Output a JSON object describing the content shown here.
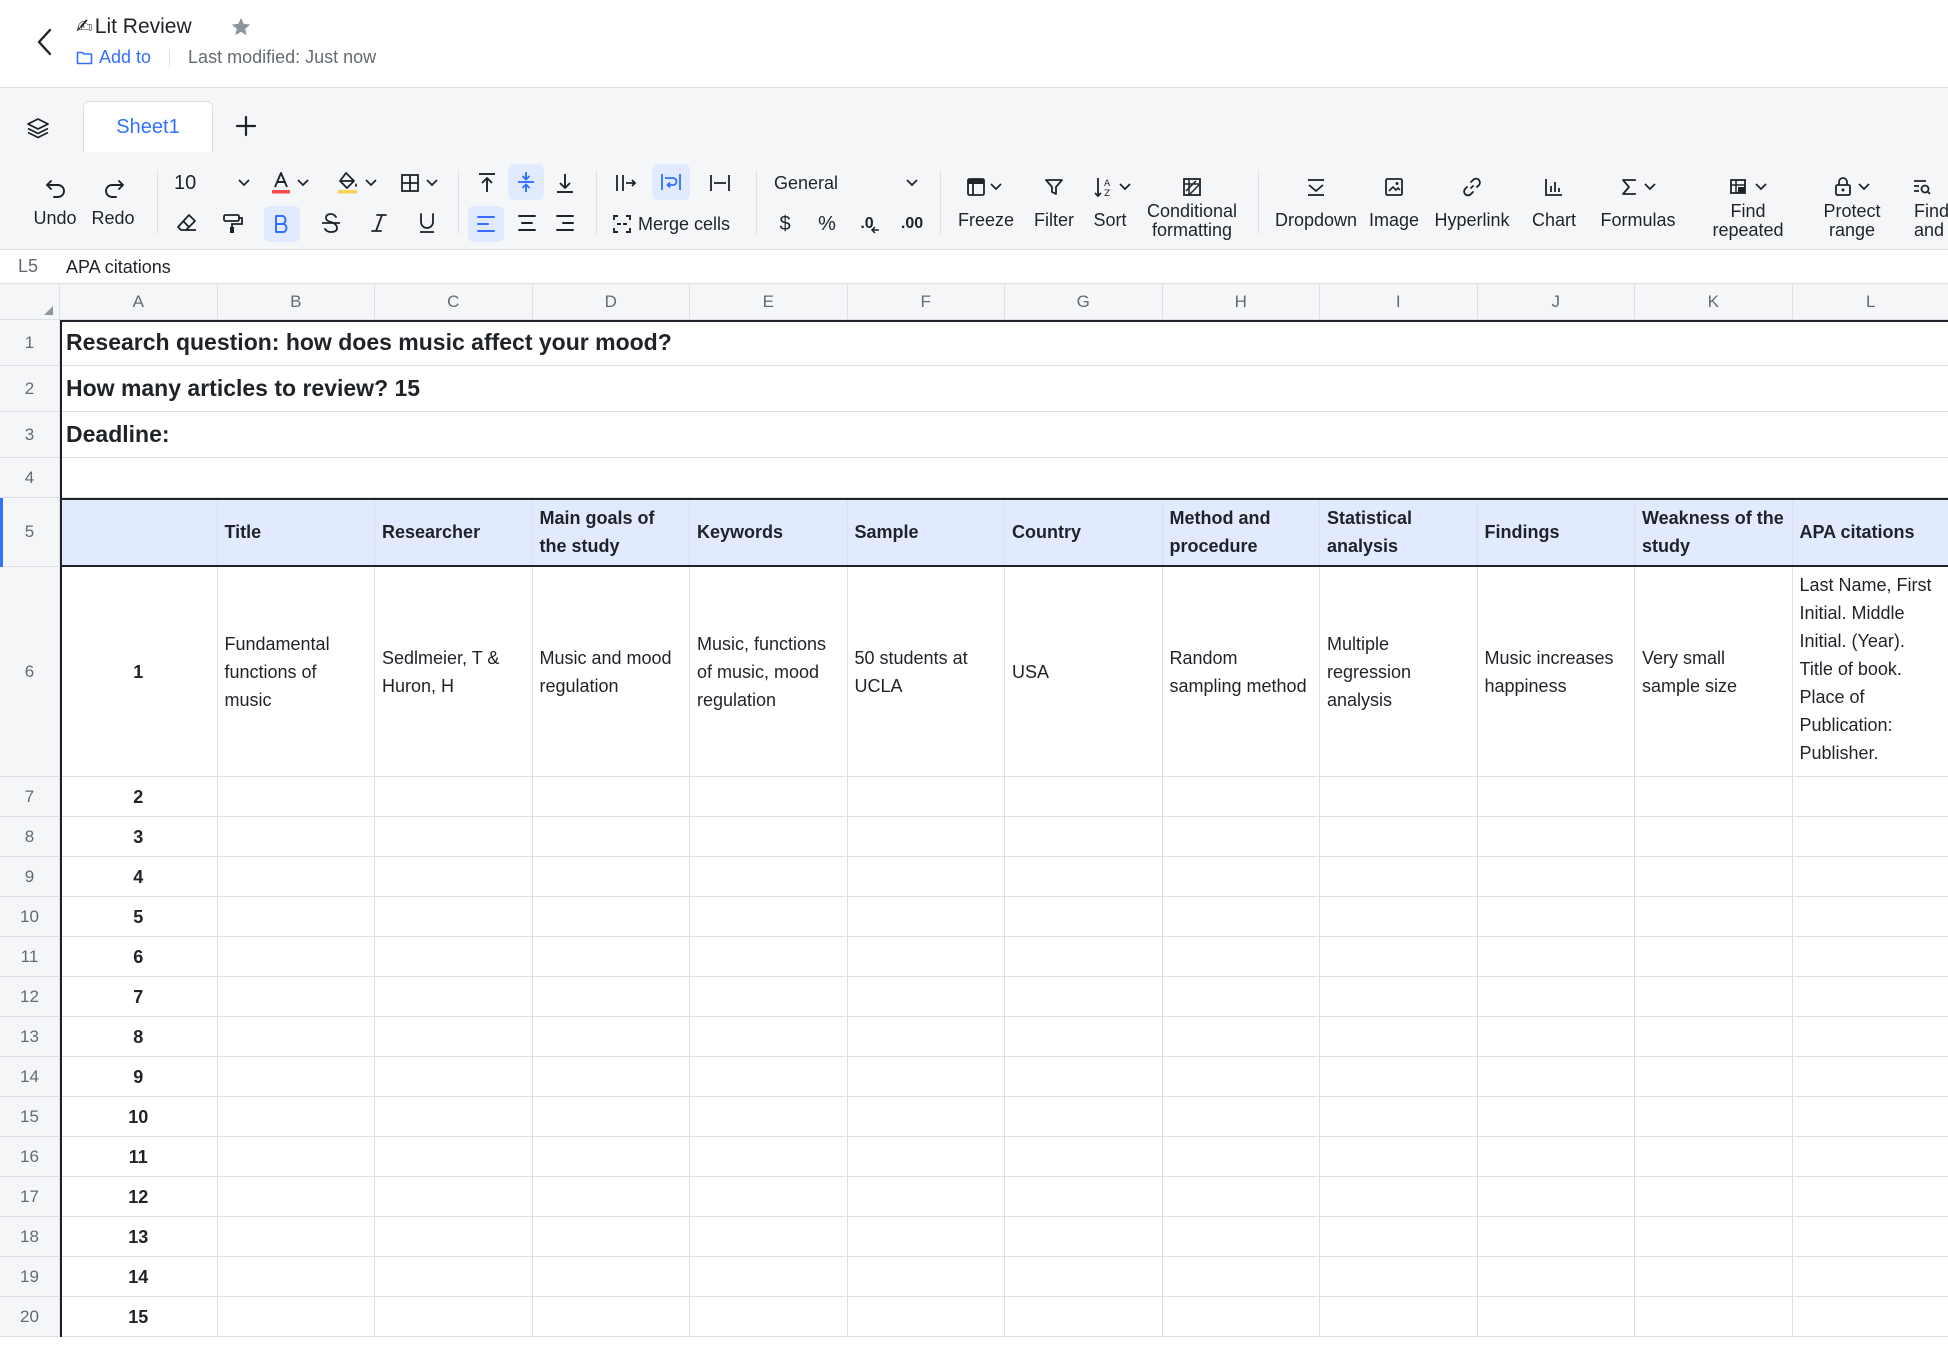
{
  "header": {
    "title_emoji": "✍",
    "title": "Lit Review",
    "add_to": "Add to",
    "last_modified": "Last modified: Just now"
  },
  "tabs": {
    "sheet1": "Sheet1"
  },
  "toolbar": {
    "undo": "Undo",
    "redo": "Redo",
    "font_size": "10",
    "merge_cells": "Merge cells",
    "number_format": "General",
    "currency": "$",
    "percent": "%",
    "dec_decrease": ".0",
    "dec_increase": ".00",
    "freeze": "Freeze",
    "filter": "Filter",
    "sort": "Sort",
    "conditional_formatting": "Conditional formatting",
    "dropdown": "Dropdown",
    "image": "Image",
    "hyperlink": "Hyperlink",
    "chart": "Chart",
    "formulas": "Formulas",
    "find_repeated": "Find repeated",
    "protect_range": "Protect range",
    "find_and": "Find and"
  },
  "formula_bar": {
    "cell_ref": "L5",
    "value": "APA citations"
  },
  "colors": {
    "accent": "#3370ff",
    "header_fill": "#e1eaff",
    "grid": "#dee0e3",
    "font_color_bar": "#f54a45",
    "fill_color_bar": "#fad355"
  },
  "columns": [
    "A",
    "B",
    "C",
    "D",
    "E",
    "F",
    "G",
    "H",
    "I",
    "J",
    "K",
    "L"
  ],
  "row_numbers": [
    "1",
    "2",
    "3",
    "4",
    "5",
    "6",
    "7",
    "8",
    "9",
    "10",
    "11",
    "12",
    "13",
    "14",
    "15",
    "16",
    "17",
    "18",
    "19",
    "20"
  ],
  "sheet": {
    "row1": "Research question: how does music affect your mood?",
    "row2": "How many articles to review? 15",
    "row3": "Deadline:",
    "headers": [
      "",
      "Title",
      "Researcher",
      "Main goals of the study",
      "Keywords",
      "Sample",
      "Country",
      "Method and procedure",
      "Statistical analysis",
      "Findings",
      "Weakness of the study",
      "APA citations"
    ],
    "row6": [
      "1",
      "Fundamental functions of music",
      "Sedlmeier, T & Huron, H",
      "Music and mood regulation",
      "Music, functions of music, mood regulation",
      "50 students at UCLA",
      "USA",
      "Random sampling method",
      "Multiple regression analysis",
      "Music increases happiness",
      "Very small sample size",
      "Last Name, First Initial. Middle Initial. (Year). Title of book. Place of Publication: Publisher."
    ],
    "index_values": [
      "2",
      "3",
      "4",
      "5",
      "6",
      "7",
      "8",
      "9",
      "10",
      "11",
      "12",
      "13",
      "14",
      "15"
    ]
  }
}
